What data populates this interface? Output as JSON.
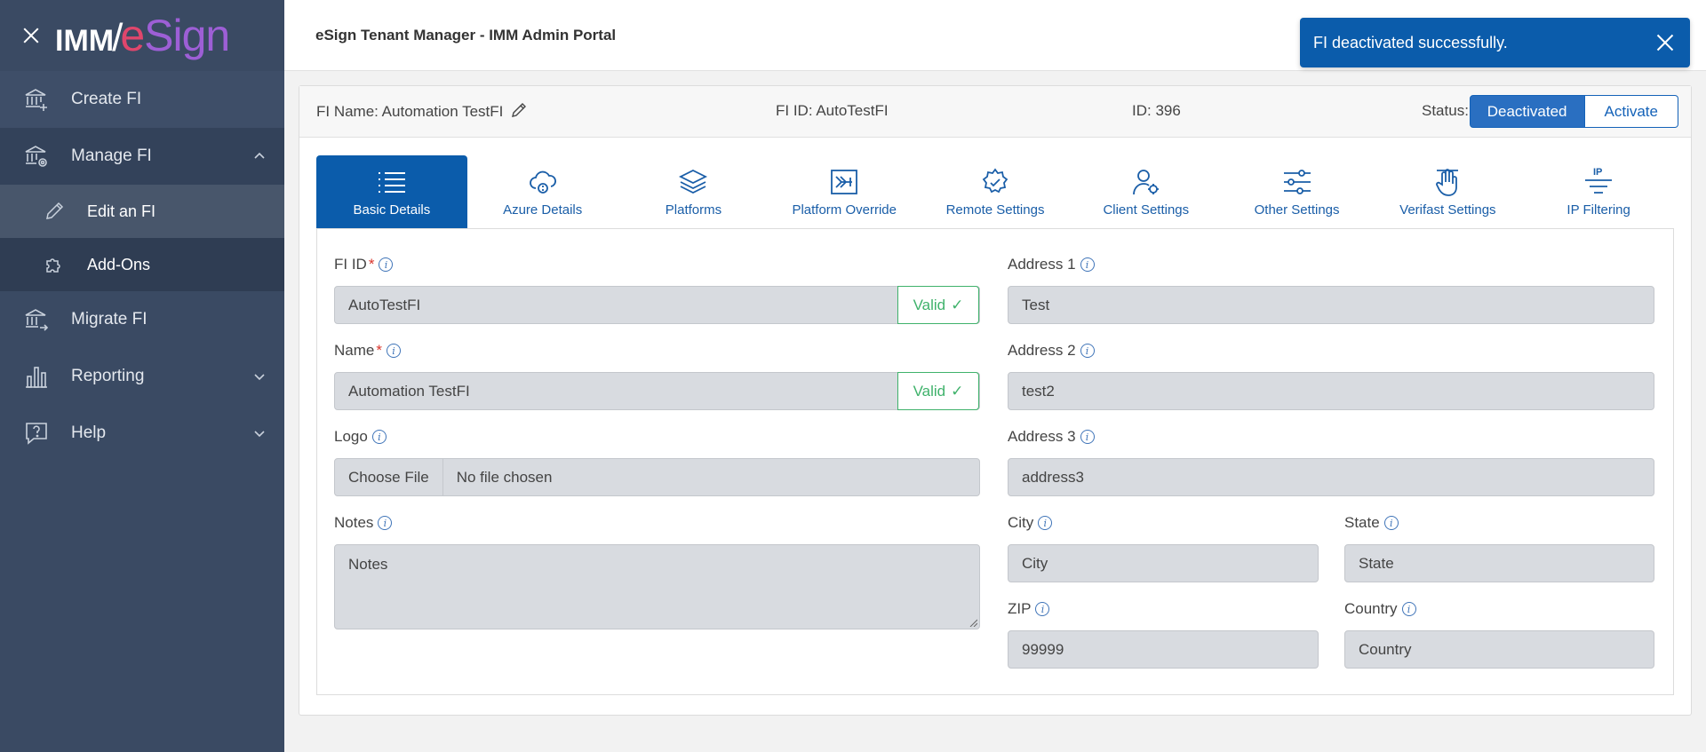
{
  "sidebar": {
    "items": [
      {
        "label": "Create FI",
        "icon": "bank-plus-icon"
      },
      {
        "label": "Manage FI",
        "icon": "bank-gear-icon"
      },
      {
        "label": "Edit an FI",
        "icon": "pencil-icon"
      },
      {
        "label": "Add-Ons",
        "icon": "puzzle-icon"
      },
      {
        "label": "Migrate FI",
        "icon": "bank-arrow-icon"
      },
      {
        "label": "Reporting",
        "icon": "bar-chart-icon"
      },
      {
        "label": "Help",
        "icon": "help-bubble-icon"
      }
    ]
  },
  "brand": {
    "imm": "IMM",
    "slash": "/",
    "esign_e": "e",
    "esign_rest": "Sign"
  },
  "header": {
    "title": "eSign Tenant Manager - IMM Admin Portal"
  },
  "toast": {
    "message": "FI deactivated successfully."
  },
  "card": {
    "fi_name": "FI Name: Automation TestFI",
    "fi_id": "FI ID: AutoTestFI",
    "id": "ID: 396",
    "status_label": "Status:",
    "status_active": "Deactivated",
    "status_other": "Activate"
  },
  "tabs": [
    {
      "label": "Basic Details",
      "icon": "list-icon"
    },
    {
      "label": "Azure Details",
      "icon": "cloud-icon"
    },
    {
      "label": "Platforms",
      "icon": "layers-icon"
    },
    {
      "label": "Platform Override",
      "icon": "override-icon"
    },
    {
      "label": "Remote Settings",
      "icon": "gear-icon"
    },
    {
      "label": "Client Settings",
      "icon": "user-gear-icon"
    },
    {
      "label": "Other Settings",
      "icon": "sliders-icon"
    },
    {
      "label": "Verifast Settings",
      "icon": "hand-icon"
    },
    {
      "label": "IP Filtering",
      "icon": "ip-filter-icon"
    }
  ],
  "form": {
    "fi_id": {
      "label": "FI ID",
      "required": "*",
      "value": "AutoTestFI",
      "validation": "Valid"
    },
    "name": {
      "label": "Name",
      "required": "*",
      "value": "Automation TestFI",
      "validation": "Valid"
    },
    "logo": {
      "label": "Logo",
      "button": "Choose File",
      "value": "No file chosen"
    },
    "notes": {
      "label": "Notes",
      "value": "Notes"
    },
    "address1": {
      "label": "Address 1",
      "value": "Test"
    },
    "address2": {
      "label": "Address 2",
      "value": "test2"
    },
    "address3": {
      "label": "Address 3",
      "value": "address3"
    },
    "city": {
      "label": "City",
      "value": "City"
    },
    "state": {
      "label": "State",
      "value": "State"
    },
    "zip": {
      "label": "ZIP",
      "value": "99999"
    },
    "country": {
      "label": "Country",
      "value": "Country"
    }
  },
  "info_glyph": "i",
  "check_glyph": "✓",
  "colors": {
    "sidebar": "#3a4a63",
    "accent": "#0b5cab",
    "valid": "#3fb26b",
    "required": "#d9342b"
  }
}
